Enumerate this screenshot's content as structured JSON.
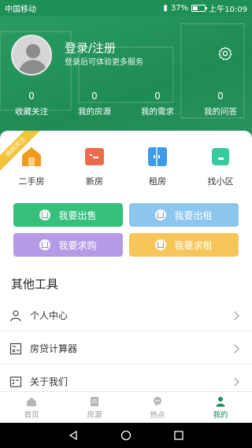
{
  "status_bar": {
    "carrier": "中国移动",
    "battery": "37%",
    "time": "上午10:09"
  },
  "header": {
    "login_title": "登录/注册",
    "login_subtitle": "登录后可体验更多服务",
    "stats": [
      {
        "value": "0",
        "label": "收藏关注"
      },
      {
        "value": "0",
        "label": "我的房源"
      },
      {
        "value": "0",
        "label": "我的需求"
      },
      {
        "value": "0",
        "label": "我的问答"
      }
    ]
  },
  "ribbon": "我的关注",
  "categories": [
    {
      "label": "二手房",
      "icon": "secondhand-house-icon",
      "color": "#f39a1e"
    },
    {
      "label": "新房",
      "icon": "new-house-icon",
      "color": "#ee6a4f"
    },
    {
      "label": "租房",
      "icon": "rent-house-icon",
      "color": "#3d9be9"
    },
    {
      "label": "找小区",
      "icon": "community-icon",
      "color": "#37c9a0"
    }
  ],
  "action_buttons": [
    {
      "label": "我要出售",
      "color": "#36c07b"
    },
    {
      "label": "我要出租",
      "color": "#8cc6ee"
    },
    {
      "label": "我要求购",
      "color": "#b59ae6"
    },
    {
      "label": "我要求租",
      "color": "#f7c65a"
    }
  ],
  "tools": {
    "title": "其他工具",
    "items": [
      {
        "label": "个人中心",
        "icon": "person-icon"
      },
      {
        "label": "房贷计算器",
        "icon": "calculator-icon"
      },
      {
        "label": "关于我们",
        "icon": "about-icon"
      }
    ]
  },
  "tabbar": [
    {
      "label": "首页",
      "icon": "home-icon",
      "active": false
    },
    {
      "label": "房源",
      "icon": "listing-icon",
      "active": false
    },
    {
      "label": "热点",
      "icon": "hot-icon",
      "active": false
    },
    {
      "label": "我的",
      "icon": "profile-icon",
      "active": true
    }
  ],
  "colors": {
    "primary": "#1f8b55"
  }
}
